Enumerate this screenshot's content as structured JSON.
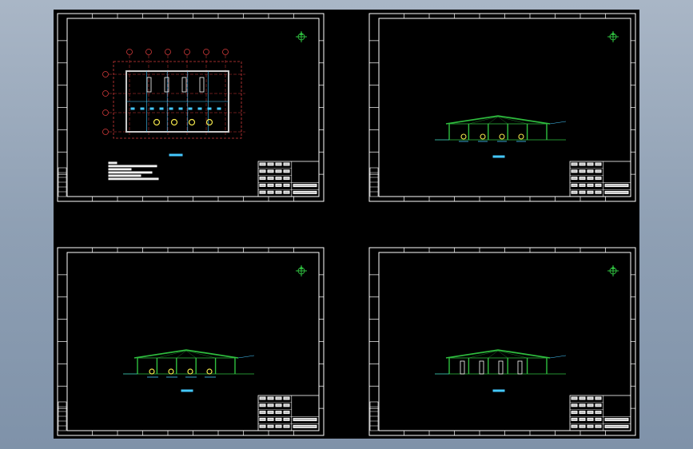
{
  "app": {
    "title": ""
  },
  "colors": {
    "background": "#8fa0b4",
    "canvas": "#000000",
    "frame": "#ffffff",
    "grid_red": "#d23a3a",
    "structure_green": "#2fbf3f",
    "accent_yellow": "#f2e64b",
    "accent_cyan": "#44c8ff",
    "walls_gray": "#c8c8c8"
  },
  "sheets": [
    {
      "id": "sheet-1",
      "kind": "floor-plan",
      "icon": "north-arrow-icon"
    },
    {
      "id": "sheet-2",
      "kind": "elevation-type-a",
      "icon": "north-arrow-icon"
    },
    {
      "id": "sheet-3",
      "kind": "elevation-type-b",
      "icon": "north-arrow-icon"
    },
    {
      "id": "sheet-4",
      "kind": "elevation-type-c",
      "icon": "north-arrow-icon"
    }
  ]
}
